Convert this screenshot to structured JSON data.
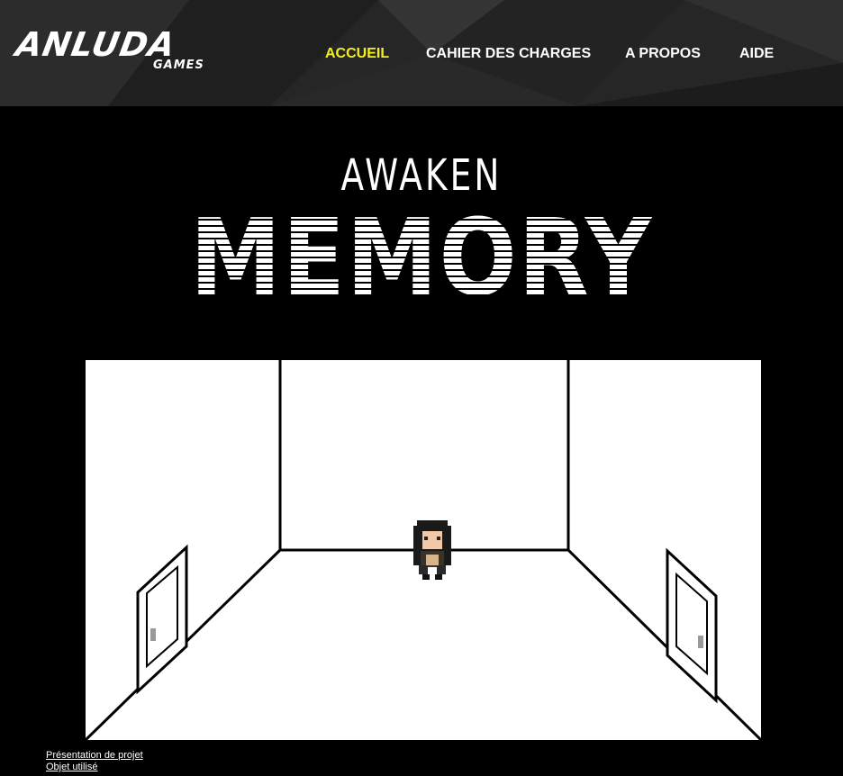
{
  "header": {
    "logo_main": "ANLUDA",
    "logo_sub": "GAMES",
    "nav": [
      {
        "label": "ACCUEIL",
        "active": true
      },
      {
        "label": "CAHIER DES CHARGES",
        "active": false
      },
      {
        "label": "A PROPOS",
        "active": false
      },
      {
        "label": "AIDE",
        "active": false
      }
    ]
  },
  "main": {
    "title_top": "AWAKEN",
    "title_main": "MEMORY",
    "game_scene": {
      "icons": [
        "left-door-icon",
        "right-door-icon",
        "character-sprite-icon"
      ]
    }
  },
  "footer": {
    "links": [
      "Présentation de projet",
      "Objet utilisé"
    ]
  },
  "colors": {
    "background": "#000000",
    "header_bg": "#262626",
    "nav_active": "#f4f01e",
    "nav_text": "#ffffff"
  }
}
